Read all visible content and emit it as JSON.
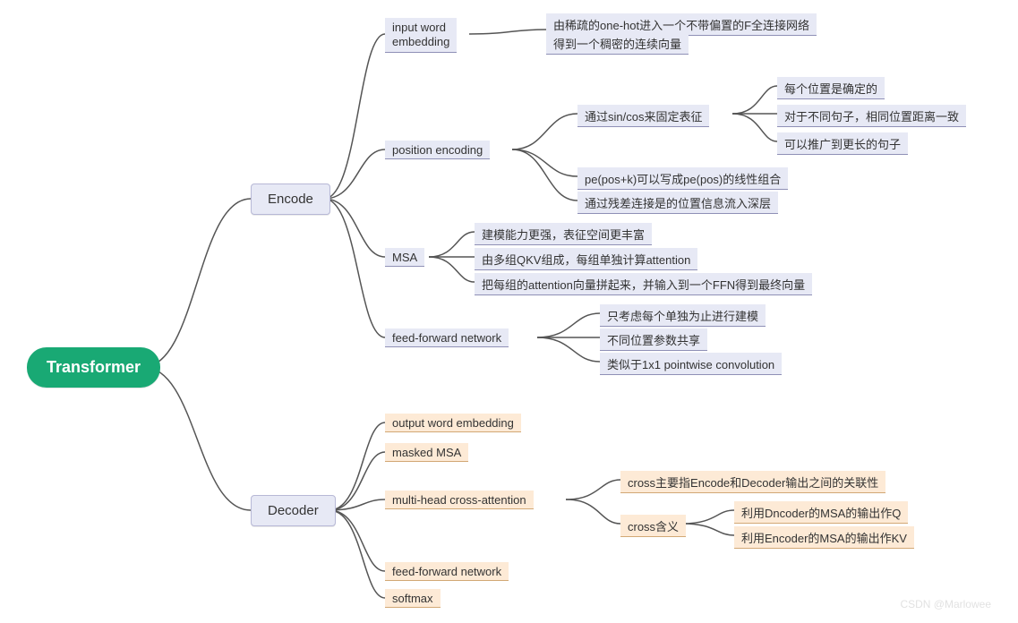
{
  "root": "Transformer",
  "encode": {
    "label": "Encode",
    "iwe": {
      "label": "input word\nembedding",
      "notes": [
        "由稀疏的one-hot进入一个不带偏置的F全连接网络",
        "得到一个稠密的连续向量"
      ]
    },
    "pe": {
      "label": "position encoding",
      "sin": {
        "label": "通过sin/cos来固定表征",
        "points": [
          "每个位置是确定的",
          "对于不同句子，相同位置距离一致",
          "可以推广到更长的句子"
        ]
      },
      "linear": "pe(pos+k)可以写成pe(pos)的线性组合",
      "residual": "通过残差连接是的位置信息流入深层"
    },
    "msa": {
      "label": "MSA",
      "points": [
        "建模能力更强，表征空间更丰富",
        "由多组QKV组成，每组单独计算attention",
        "把每组的attention向量拼起来，并输入到一个FFN得到最终向量"
      ]
    },
    "ffn": {
      "label": "feed-forward network",
      "points": [
        "只考虑每个单独为止进行建模",
        "不同位置参数共享",
        "类似于1x1 pointwise convolution"
      ]
    }
  },
  "decode": {
    "label": "Decoder",
    "owe": "output word embedding",
    "mmsa": "masked MSA",
    "cross": {
      "label": "multi-head cross-attention",
      "p1": "cross主要指Encode和Decoder输出之间的关联性",
      "meaning": {
        "label": "cross含义",
        "points": [
          "利用Dncoder的MSA的输出作Q",
          "利用Encoder的MSA的输出作KV"
        ]
      }
    },
    "ffn": "feed-forward network",
    "softmax": "softmax"
  },
  "watermark": "CSDN @Marlowee"
}
